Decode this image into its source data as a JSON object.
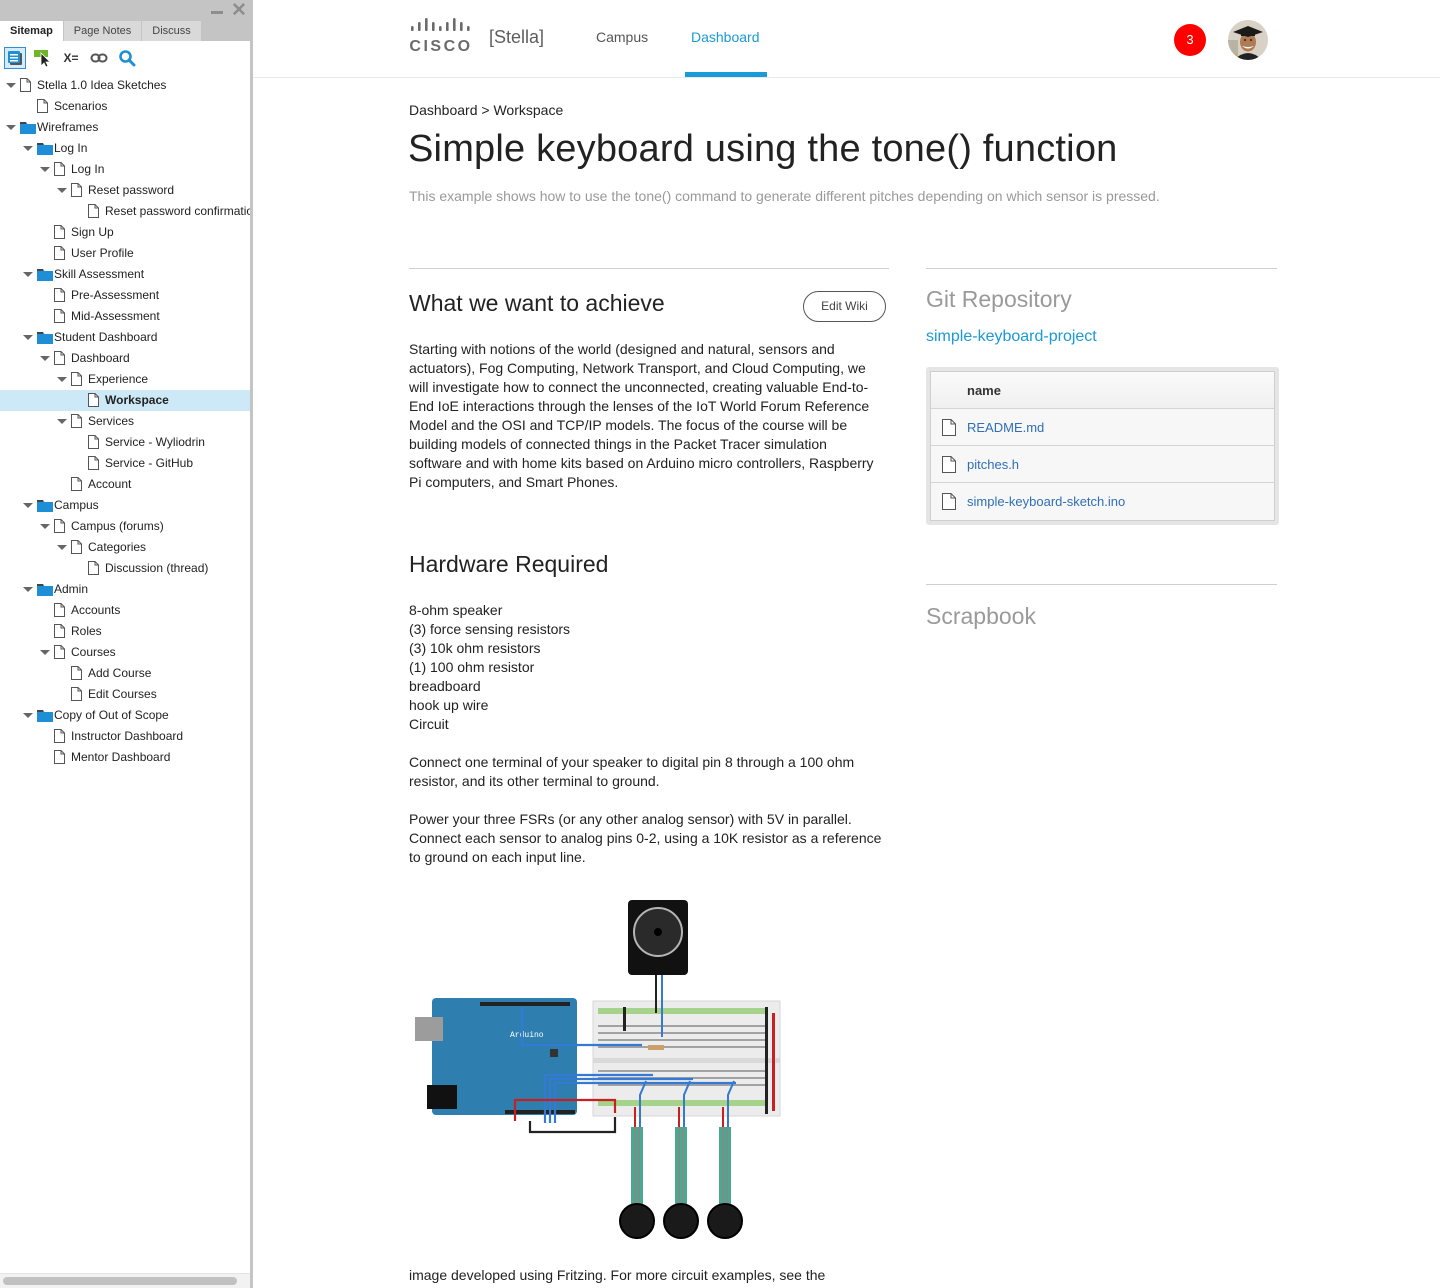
{
  "sidebar": {
    "tabs": [
      {
        "label": "Sitemap",
        "active": true
      },
      {
        "label": "Page Notes",
        "active": false
      },
      {
        "label": "Discuss",
        "active": false
      }
    ],
    "toolbar": {
      "icons": [
        "sitemap-view-icon",
        "pointer-icon",
        "variables-icon",
        "link-icon",
        "search-icon"
      ],
      "variables_label": "X="
    },
    "tree": [
      {
        "label": "Stella 1.0 Idea Sketches",
        "type": "page",
        "depth": 0,
        "expanded": true
      },
      {
        "label": "Scenarios",
        "type": "page",
        "depth": 1
      },
      {
        "label": "Wireframes",
        "type": "folder",
        "depth": 0,
        "expanded": true
      },
      {
        "label": "Log In",
        "type": "folder",
        "depth": 1,
        "expanded": true
      },
      {
        "label": "Log In",
        "type": "page",
        "depth": 2,
        "expanded": true
      },
      {
        "label": "Reset password",
        "type": "page",
        "depth": 3,
        "expanded": true
      },
      {
        "label": "Reset password confirmation",
        "type": "page",
        "depth": 4
      },
      {
        "label": "Sign Up",
        "type": "page",
        "depth": 2
      },
      {
        "label": "User Profile",
        "type": "page",
        "depth": 2
      },
      {
        "label": "Skill Assessment",
        "type": "folder",
        "depth": 1,
        "expanded": true
      },
      {
        "label": "Pre-Assessment",
        "type": "page",
        "depth": 2
      },
      {
        "label": "Mid-Assessment",
        "type": "page",
        "depth": 2
      },
      {
        "label": "Student Dashboard",
        "type": "folder",
        "depth": 1,
        "expanded": true
      },
      {
        "label": "Dashboard",
        "type": "page",
        "depth": 2,
        "expanded": true
      },
      {
        "label": "Experience",
        "type": "page",
        "depth": 3,
        "expanded": true
      },
      {
        "label": "Workspace",
        "type": "page",
        "depth": 4,
        "selected": true
      },
      {
        "label": "Services",
        "type": "page",
        "depth": 3,
        "expanded": true
      },
      {
        "label": "Service - Wyliodrin",
        "type": "page",
        "depth": 4
      },
      {
        "label": "Service - GitHub",
        "type": "page",
        "depth": 4
      },
      {
        "label": "Account",
        "type": "page",
        "depth": 3
      },
      {
        "label": "Campus",
        "type": "folder",
        "depth": 1,
        "expanded": true
      },
      {
        "label": "Campus (forums)",
        "type": "page",
        "depth": 2,
        "expanded": true
      },
      {
        "label": "Categories",
        "type": "page",
        "depth": 3,
        "expanded": true
      },
      {
        "label": "Discussion (thread)",
        "type": "page",
        "depth": 4
      },
      {
        "label": "Admin",
        "type": "folder",
        "depth": 1,
        "expanded": true
      },
      {
        "label": "Accounts",
        "type": "page",
        "depth": 2
      },
      {
        "label": "Roles",
        "type": "page",
        "depth": 2
      },
      {
        "label": "Courses",
        "type": "page",
        "depth": 2,
        "expanded": true
      },
      {
        "label": "Add Course",
        "type": "page",
        "depth": 3
      },
      {
        "label": "Edit Courses",
        "type": "page",
        "depth": 3
      },
      {
        "label": "Copy of Out of Scope",
        "type": "folder",
        "depth": 1,
        "expanded": true
      },
      {
        "label": "Instructor Dashboard",
        "type": "page",
        "depth": 2
      },
      {
        "label": "Mentor Dashboard",
        "type": "page",
        "depth": 2
      }
    ]
  },
  "header": {
    "logo_text": "CISCO",
    "brand": "[Stella]",
    "nav": [
      {
        "label": "Campus",
        "active": false
      },
      {
        "label": "Dashboard",
        "active": true
      }
    ],
    "notification_count": "3",
    "accent_color": "#1a9ad6",
    "notification_color": "#fe0000"
  },
  "breadcrumb": {
    "items": [
      "Dashboard",
      "Workspace"
    ],
    "separator": ">"
  },
  "page": {
    "title": "Simple keyboard using the tone() function",
    "subtitle": "This example shows how to use the tone() command to generate different pitches depending on which sensor is pressed."
  },
  "achieve": {
    "title": "What we want to achieve",
    "edit_button": "Edit Wiki",
    "body": "Starting with notions of the world (designed and natural, sensors and actuators), Fog Computing, Network Transport, and Cloud Computing, we will investigate how to connect the unconnected, creating valuable End-to-End IoE interactions through the lenses of  the IoT World Forum Reference Model and the OSI and TCP/IP models. The focus of the course will be building models of connected things in the Packet Tracer simulation software and with home kits based on Arduino micro controllers, Raspberry Pi computers, and Smart Phones."
  },
  "hardware": {
    "title": "Hardware Required",
    "items": [
      "8-ohm speaker",
      "(3) force sensing resistors",
      "(3) 10k ohm resistors",
      "(1) 100 ohm resistor",
      "breadboard",
      "hook up wire",
      "Circuit"
    ],
    "para1": "Connect one terminal of your speaker to digital pin 8 through a 100 ohm resistor, and its other terminal to ground.",
    "para2": "Power your three FSRs (or any other analog sensor) with 5V in parallel. Connect each sensor to analog pins 0-2, using a 10K resistor as a reference to ground on each input line.",
    "circuit_label": "Arduino",
    "caption": "image developed using Fritzing. For more circuit examples, see the"
  },
  "git": {
    "title": "Git Repository",
    "repo_name": "simple-keyboard-project",
    "column_header": "name",
    "files": [
      "README.md",
      "pitches.h",
      "simple-keyboard-sketch.ino"
    ]
  },
  "scrapbook": {
    "title": "Scrapbook"
  }
}
